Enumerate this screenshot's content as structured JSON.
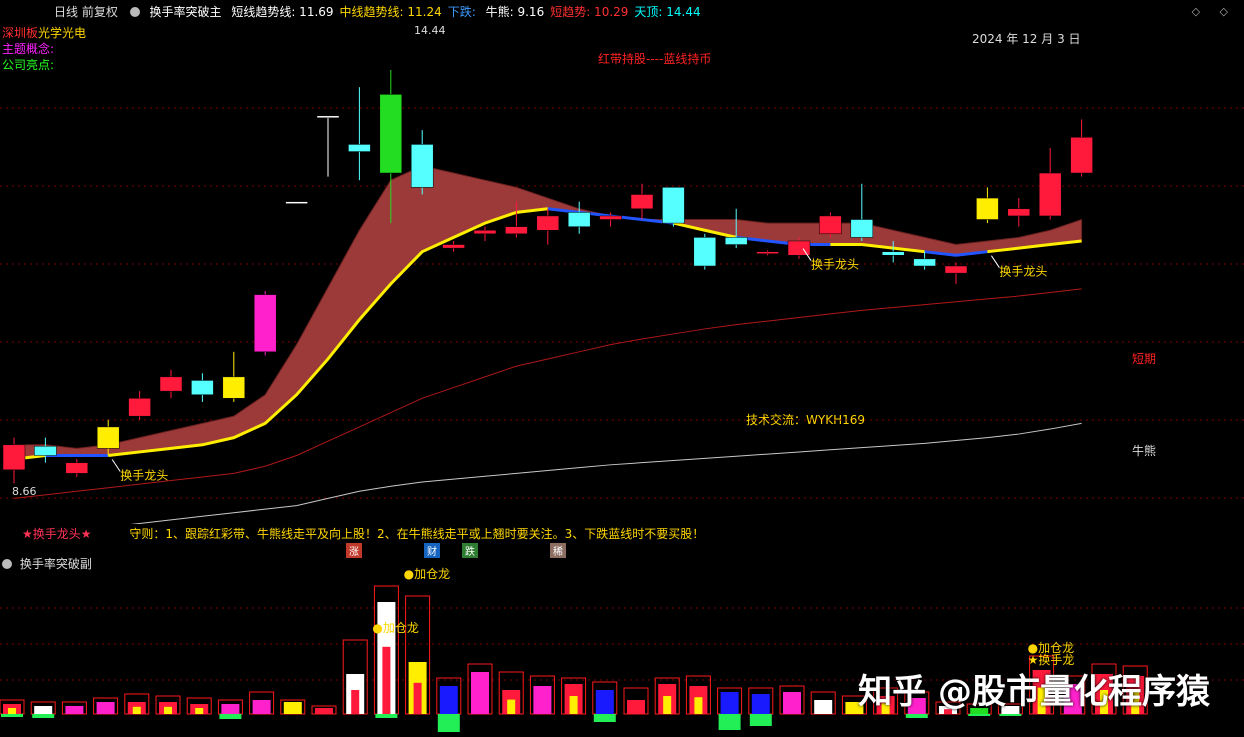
{
  "header": {
    "period": "日线 前复权",
    "indicator_name": "换手率突破主",
    "items": [
      {
        "label": "短线趋势线:",
        "value": "11.69",
        "color": "#ffffff"
      },
      {
        "label": "中线趋势线:",
        "value": "11.24",
        "color": "#ffd700"
      },
      {
        "label": "下跌:",
        "value": "",
        "color": "#3b9cff"
      },
      {
        "label": "牛熊:",
        "value": "9.16",
        "color": "#ffffff"
      },
      {
        "label": "短趋势:",
        "value": "10.29",
        "color": "#ff3030"
      },
      {
        "label": "天顶:",
        "value": "14.44",
        "color": "#00ffff"
      }
    ],
    "window_controls": "◇ ◇"
  },
  "info": {
    "market_label": "深圳板",
    "stock_name": "光学光电",
    "theme_label": "主题概念:",
    "company_label": "公司亮点:"
  },
  "annotations": {
    "date": "2024 年 12 月 3 日",
    "slogan": "红带持股----蓝线持币",
    "contact": "技术交流：WYKH169",
    "short_label": "短期",
    "bull_label": "牛熊",
    "signal_label": "换手龙头",
    "high_label": "14.44",
    "low_label": "8.66",
    "signal_legend": "★换手龙头★",
    "rule_text": "守则：1、跟踪红彩带、牛熊线走平及向上股！2、在牛熊线走平或上翘时要关注。3、下跌蓝线时不要买股！",
    "tags": [
      {
        "text": "涨",
        "color": "#c0392b"
      },
      {
        "text": "财",
        "color": "#1565c0"
      },
      {
        "text": "跌",
        "color": "#2e7d32"
      },
      {
        "text": "稀",
        "color": "#8d6e63"
      }
    ]
  },
  "sub_panel": {
    "title": "换手率突破副",
    "add_label": "加仓龙",
    "signal_label": "换手龙"
  },
  "watermark": "知乎 @股市量化程序猿",
  "colors": {
    "up": "#ff1a3c",
    "down": "#55ffff",
    "ribbon": "#9c3a3a",
    "mid_line": "#ffee00",
    "down_line": "#2255ff",
    "short_line": "#b01818",
    "bull_line": "#c8c8c8",
    "magenta": "#ff22cc"
  },
  "chart_data": {
    "type": "candlestick",
    "ylim": [
      8.4,
      15.0
    ],
    "candles": [
      {
        "o": 9.2,
        "c": 8.85,
        "h": 9.3,
        "l": 8.66,
        "color": "red"
      },
      {
        "o": 9.05,
        "c": 9.18,
        "h": 9.3,
        "l": 8.95,
        "color": "cyan"
      },
      {
        "o": 8.95,
        "c": 8.8,
        "h": 9.0,
        "l": 8.75,
        "color": "red"
      },
      {
        "o": 9.15,
        "c": 9.45,
        "h": 9.55,
        "l": 9.05,
        "color": "yellow"
      },
      {
        "o": 9.6,
        "c": 9.85,
        "h": 9.95,
        "l": 9.55,
        "color": "red"
      },
      {
        "o": 9.95,
        "c": 10.15,
        "h": 10.25,
        "l": 9.85,
        "color": "red"
      },
      {
        "o": 10.1,
        "c": 9.9,
        "h": 10.2,
        "l": 9.8,
        "color": "cyan"
      },
      {
        "o": 9.85,
        "c": 10.15,
        "h": 10.5,
        "l": 9.8,
        "color": "yellow"
      },
      {
        "o": 10.5,
        "c": 11.3,
        "h": 11.35,
        "l": 10.45,
        "color": "magenta"
      },
      {
        "o": 12.6,
        "c": 12.6,
        "h": 12.6,
        "l": 12.6,
        "color": "white"
      },
      {
        "o": 13.8,
        "c": 13.8,
        "h": 13.8,
        "l": 12.95,
        "color": "white"
      },
      {
        "o": 13.3,
        "c": 13.4,
        "h": 14.2,
        "l": 12.9,
        "color": "cyan"
      },
      {
        "o": 13.0,
        "c": 14.1,
        "h": 14.44,
        "l": 12.3,
        "color": "green"
      },
      {
        "o": 13.4,
        "c": 12.8,
        "h": 13.6,
        "l": 12.7,
        "color": "cyan"
      },
      {
        "o": 11.95,
        "c": 12.0,
        "h": 12.05,
        "l": 11.9,
        "color": "red"
      },
      {
        "o": 12.2,
        "c": 12.15,
        "h": 12.25,
        "l": 12.05,
        "color": "red"
      },
      {
        "o": 12.15,
        "c": 12.25,
        "h": 12.6,
        "l": 12.1,
        "color": "red"
      },
      {
        "o": 12.2,
        "c": 12.4,
        "h": 12.5,
        "l": 12.0,
        "color": "red"
      },
      {
        "o": 12.45,
        "c": 12.25,
        "h": 12.6,
        "l": 12.15,
        "color": "cyan"
      },
      {
        "o": 12.4,
        "c": 12.35,
        "h": 12.45,
        "l": 12.25,
        "color": "red"
      },
      {
        "o": 12.5,
        "c": 12.7,
        "h": 12.85,
        "l": 12.35,
        "color": "red"
      },
      {
        "o": 12.8,
        "c": 12.3,
        "h": 12.8,
        "l": 12.25,
        "color": "cyan"
      },
      {
        "o": 12.1,
        "c": 11.7,
        "h": 12.15,
        "l": 11.65,
        "color": "cyan"
      },
      {
        "o": 12.0,
        "c": 12.1,
        "h": 12.5,
        "l": 11.95,
        "color": "cyan"
      },
      {
        "o": 11.9,
        "c": 11.88,
        "h": 11.92,
        "l": 11.85,
        "color": "red"
      },
      {
        "o": 11.85,
        "c": 12.05,
        "h": 12.1,
        "l": 11.8,
        "color": "red"
      },
      {
        "o": 12.15,
        "c": 12.4,
        "h": 12.45,
        "l": 12.1,
        "color": "red"
      },
      {
        "o": 12.35,
        "c": 12.1,
        "h": 12.85,
        "l": 12.05,
        "color": "cyan"
      },
      {
        "o": 11.9,
        "c": 11.85,
        "h": 12.05,
        "l": 11.75,
        "color": "cyan"
      },
      {
        "o": 11.8,
        "c": 11.7,
        "h": 11.9,
        "l": 11.65,
        "color": "cyan"
      },
      {
        "o": 11.7,
        "c": 11.6,
        "h": 11.75,
        "l": 11.45,
        "color": "red"
      },
      {
        "o": 12.35,
        "c": 12.65,
        "h": 12.8,
        "l": 12.3,
        "color": "yellow"
      },
      {
        "o": 12.4,
        "c": 12.5,
        "h": 12.65,
        "l": 12.25,
        "color": "red"
      },
      {
        "o": 12.4,
        "c": 13.0,
        "h": 13.35,
        "l": 12.35,
        "color": "red"
      },
      {
        "o": 13.0,
        "c": 13.5,
        "h": 13.75,
        "l": 12.95,
        "color": "red"
      }
    ],
    "ribbon_upper": [
      9.2,
      9.2,
      9.15,
      9.2,
      9.3,
      9.4,
      9.5,
      9.6,
      9.9,
      10.6,
      11.4,
      12.2,
      12.9,
      13.1,
      13.0,
      12.9,
      12.8,
      12.65,
      12.5,
      12.4,
      12.35,
      12.35,
      12.35,
      12.35,
      12.3,
      12.3,
      12.3,
      12.3,
      12.2,
      12.1,
      12.0,
      12.05,
      12.1,
      12.2,
      12.35
    ],
    "ribbon_lower": [
      9.0,
      9.05,
      9.05,
      9.05,
      9.1,
      9.15,
      9.2,
      9.3,
      9.5,
      9.9,
      10.4,
      10.95,
      11.45,
      11.9,
      12.1,
      12.3,
      12.45,
      12.5,
      12.45,
      12.4,
      12.35,
      12.3,
      12.2,
      12.1,
      12.05,
      12.0,
      12.0,
      12.0,
      11.95,
      11.9,
      11.85,
      11.9,
      11.95,
      12.0,
      12.05
    ],
    "trend_segments": [
      {
        "from": 0,
        "to": 1,
        "color": "yellow"
      },
      {
        "from": 1,
        "to": 3,
        "color": "blue"
      },
      {
        "from": 3,
        "to": 17,
        "color": "yellow"
      },
      {
        "from": 17,
        "to": 21,
        "color": "blue"
      },
      {
        "from": 21,
        "to": 23,
        "color": "yellow"
      },
      {
        "from": 23,
        "to": 26,
        "color": "blue"
      },
      {
        "from": 26,
        "to": 29,
        "color": "yellow"
      },
      {
        "from": 29,
        "to": 31,
        "color": "blue"
      },
      {
        "from": 31,
        "to": 34,
        "color": "yellow"
      }
    ],
    "short_line": [
      8.45,
      8.5,
      8.55,
      8.6,
      8.65,
      8.7,
      8.75,
      8.8,
      8.9,
      9.05,
      9.25,
      9.45,
      9.65,
      9.85,
      10.0,
      10.15,
      10.3,
      10.4,
      10.5,
      10.6,
      10.68,
      10.75,
      10.82,
      10.88,
      10.93,
      10.98,
      11.03,
      11.08,
      11.12,
      11.16,
      11.2,
      11.24,
      11.28,
      11.33,
      11.38
    ],
    "bull_line": [
      7.9,
      7.95,
      8.0,
      8.05,
      8.1,
      8.15,
      8.2,
      8.25,
      8.3,
      8.35,
      8.45,
      8.55,
      8.62,
      8.68,
      8.72,
      8.76,
      8.8,
      8.84,
      8.88,
      8.92,
      8.95,
      8.98,
      9.01,
      9.04,
      9.07,
      9.1,
      9.13,
      9.16,
      9.19,
      9.22,
      9.26,
      9.3,
      9.35,
      9.42,
      9.5
    ],
    "signals": [
      3,
      25,
      31
    ],
    "sub_volumes": [
      {
        "box": 14,
        "bar": 10,
        "kind": "red-yellow",
        "neg": 3
      },
      {
        "box": 12,
        "bar": 8,
        "kind": "white",
        "neg": 4
      },
      {
        "box": 12,
        "bar": 8,
        "kind": "magenta",
        "neg": 0
      },
      {
        "box": 16,
        "bar": 12,
        "kind": "magenta",
        "neg": 0
      },
      {
        "box": 20,
        "bar": 12,
        "kind": "red-yellow",
        "neg": 0
      },
      {
        "box": 18,
        "bar": 12,
        "kind": "red-yellow",
        "neg": 0
      },
      {
        "box": 16,
        "bar": 10,
        "kind": "red-yellow",
        "neg": 0
      },
      {
        "box": 14,
        "bar": 10,
        "kind": "magenta",
        "neg": 5
      },
      {
        "box": 22,
        "bar": 14,
        "kind": "magenta",
        "neg": 0
      },
      {
        "box": 14,
        "bar": 12,
        "kind": "yellow",
        "neg": 0
      },
      {
        "box": 8,
        "bar": 6,
        "kind": "red",
        "neg": 0
      },
      {
        "box": 74,
        "bar": 40,
        "kind": "white-red",
        "neg": 0
      },
      {
        "box": 128,
        "bar": 112,
        "kind": "white-red",
        "neg": 4
      },
      {
        "box": 118,
        "bar": 52,
        "kind": "yellow-red",
        "neg": 0
      },
      {
        "box": 36,
        "bar": 28,
        "kind": "blue",
        "neg": 18
      },
      {
        "box": 50,
        "bar": 42,
        "kind": "magenta",
        "neg": 0
      },
      {
        "box": 42,
        "bar": 24,
        "kind": "red-yellow",
        "neg": 0
      },
      {
        "box": 38,
        "bar": 28,
        "kind": "magenta",
        "neg": 0
      },
      {
        "box": 36,
        "bar": 30,
        "kind": "red-yellow",
        "neg": 0
      },
      {
        "box": 32,
        "bar": 24,
        "kind": "blue",
        "neg": 8
      },
      {
        "box": 26,
        "bar": 14,
        "kind": "red",
        "neg": 0
      },
      {
        "box": 36,
        "bar": 30,
        "kind": "red-yellow",
        "neg": 0
      },
      {
        "box": 38,
        "bar": 28,
        "kind": "red-yellow",
        "neg": 0
      },
      {
        "box": 26,
        "bar": 22,
        "kind": "blue",
        "neg": 16
      },
      {
        "box": 26,
        "bar": 20,
        "kind": "blue",
        "neg": 12
      },
      {
        "box": 28,
        "bar": 22,
        "kind": "magenta",
        "neg": 0
      },
      {
        "box": 22,
        "bar": 14,
        "kind": "white",
        "neg": 0
      },
      {
        "box": 18,
        "bar": 12,
        "kind": "yellow",
        "neg": 0
      },
      {
        "box": 26,
        "bar": 18,
        "kind": "red-yellow",
        "neg": 0
      },
      {
        "box": 22,
        "bar": 16,
        "kind": "magenta",
        "neg": 4
      },
      {
        "box": 12,
        "bar": 8,
        "kind": "white-red",
        "neg": 0
      },
      {
        "box": 10,
        "bar": 6,
        "kind": "green",
        "neg": 2
      },
      {
        "box": 10,
        "bar": 8,
        "kind": "white",
        "neg": 2
      },
      {
        "box": 58,
        "bar": 44,
        "kind": "red-yellow",
        "neg": 0
      },
      {
        "box": 38,
        "bar": 30,
        "kind": "magenta",
        "neg": 0
      },
      {
        "box": 50,
        "bar": 40,
        "kind": "red-yellow",
        "neg": 0
      },
      {
        "box": 48,
        "bar": 38,
        "kind": "red-yellow",
        "neg": 0
      }
    ]
  }
}
